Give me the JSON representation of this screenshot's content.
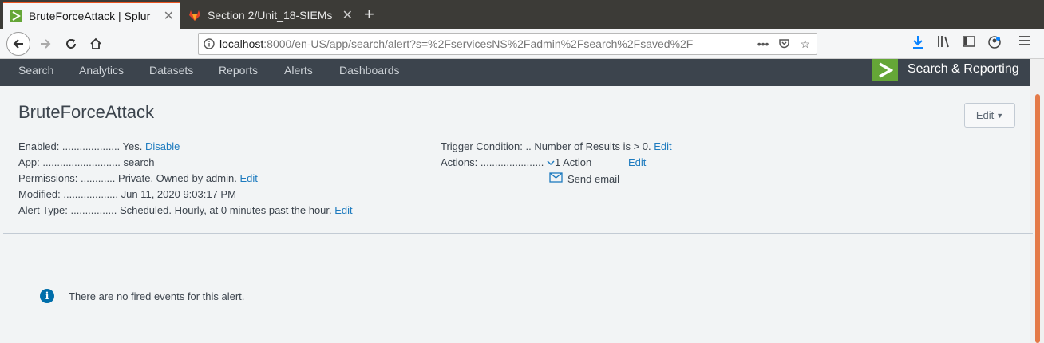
{
  "browser": {
    "tabs": [
      {
        "title": "BruteForceAttack | Splur",
        "active": true,
        "icon": "splunk-icon"
      },
      {
        "title": "Section 2/Unit_18-SIEMs",
        "active": false,
        "icon": "gitlab-icon"
      }
    ],
    "url_host": "localhost",
    "url_rest": ":8000/en-US/app/search/alert?s=%2FservicesNS%2Fadmin%2Fsearch%2Fsaved%2F"
  },
  "appbar": {
    "nav": [
      "Search",
      "Analytics",
      "Datasets",
      "Reports",
      "Alerts",
      "Dashboards"
    ],
    "app_name": "Search & Reporting",
    "logo_color": "#65a637"
  },
  "alert": {
    "title": "BruteForceAttack",
    "edit_button": "Edit",
    "left": [
      {
        "label": "Enabled: ....................",
        "value": "Yes.",
        "link": "Disable"
      },
      {
        "label": "App: ...........................",
        "value": "search",
        "link": ""
      },
      {
        "label": "Permissions: ............",
        "value": "Private. Owned by admin.",
        "link": "Edit"
      },
      {
        "label": "Modified: ...................",
        "value": "Jun 11, 2020 9:03:17 PM",
        "link": ""
      },
      {
        "label": "Alert Type: ................",
        "value": "Scheduled. Hourly, at 0 minutes past the hour.",
        "link": "Edit"
      }
    ],
    "trigger_label": "Trigger Condition: ..",
    "trigger_value": "Number of Results is > 0.",
    "trigger_link": "Edit",
    "actions_label": "Actions: ......................",
    "actions_value": "1 Action",
    "actions_link": "Edit",
    "action_item": "Send email"
  },
  "empty_message": "There are no fired events for this alert.",
  "colors": {
    "accent": "#e95420",
    "link": "#1e7bbf",
    "info": "#006eaa"
  }
}
